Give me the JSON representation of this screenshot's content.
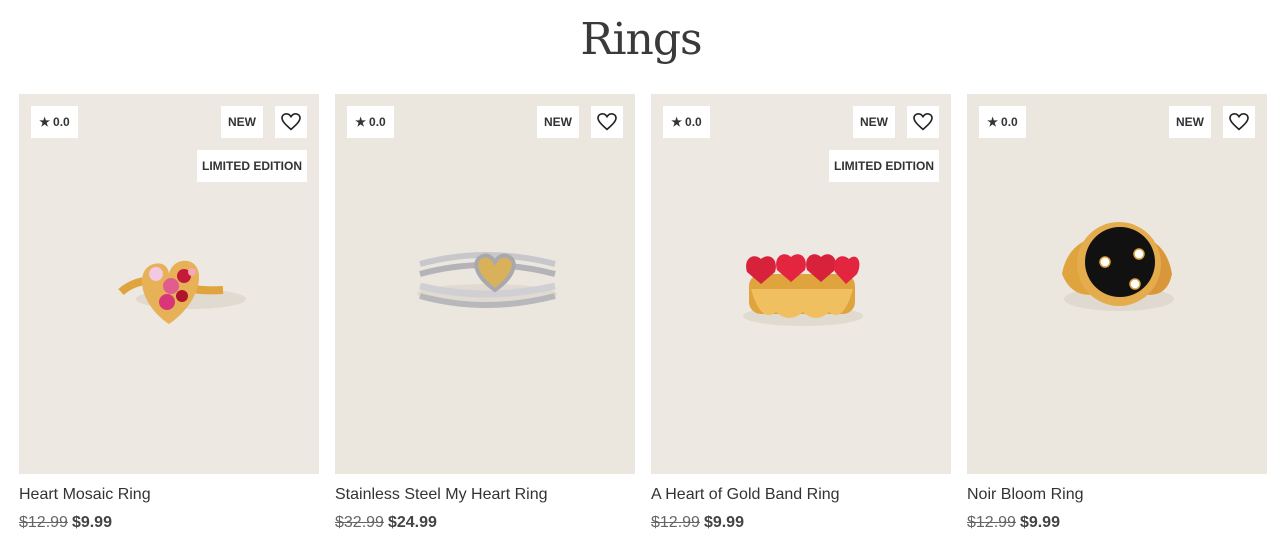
{
  "page": {
    "title": "Rings"
  },
  "products": [
    {
      "name": "Heart Mosaic Ring",
      "rating": "0.0",
      "new_badge": "NEW",
      "limited_badge": "LIMITED EDITION",
      "old_price": "$12.99",
      "price": "$9.99",
      "icon": "heart-outline-icon"
    },
    {
      "name": "Stainless Steel My Heart Ring",
      "rating": "0.0",
      "new_badge": "NEW",
      "old_price": "$32.99",
      "price": "$24.99",
      "icon": "heart-outline-icon"
    },
    {
      "name": "A Heart of Gold Band Ring",
      "rating": "0.0",
      "new_badge": "NEW",
      "limited_badge": "LIMITED EDITION",
      "old_price": "$12.99",
      "price": "$9.99",
      "icon": "heart-outline-icon"
    },
    {
      "name": "Noir Bloom Ring",
      "rating": "0.0",
      "new_badge": "NEW",
      "old_price": "$12.99",
      "price": "$9.99",
      "icon": "heart-outline-icon"
    }
  ],
  "colors": {
    "image_bg": "#ede8e1",
    "text": "#333333",
    "gold": "#d9a441",
    "red": "#d9223a",
    "black": "#111111"
  }
}
